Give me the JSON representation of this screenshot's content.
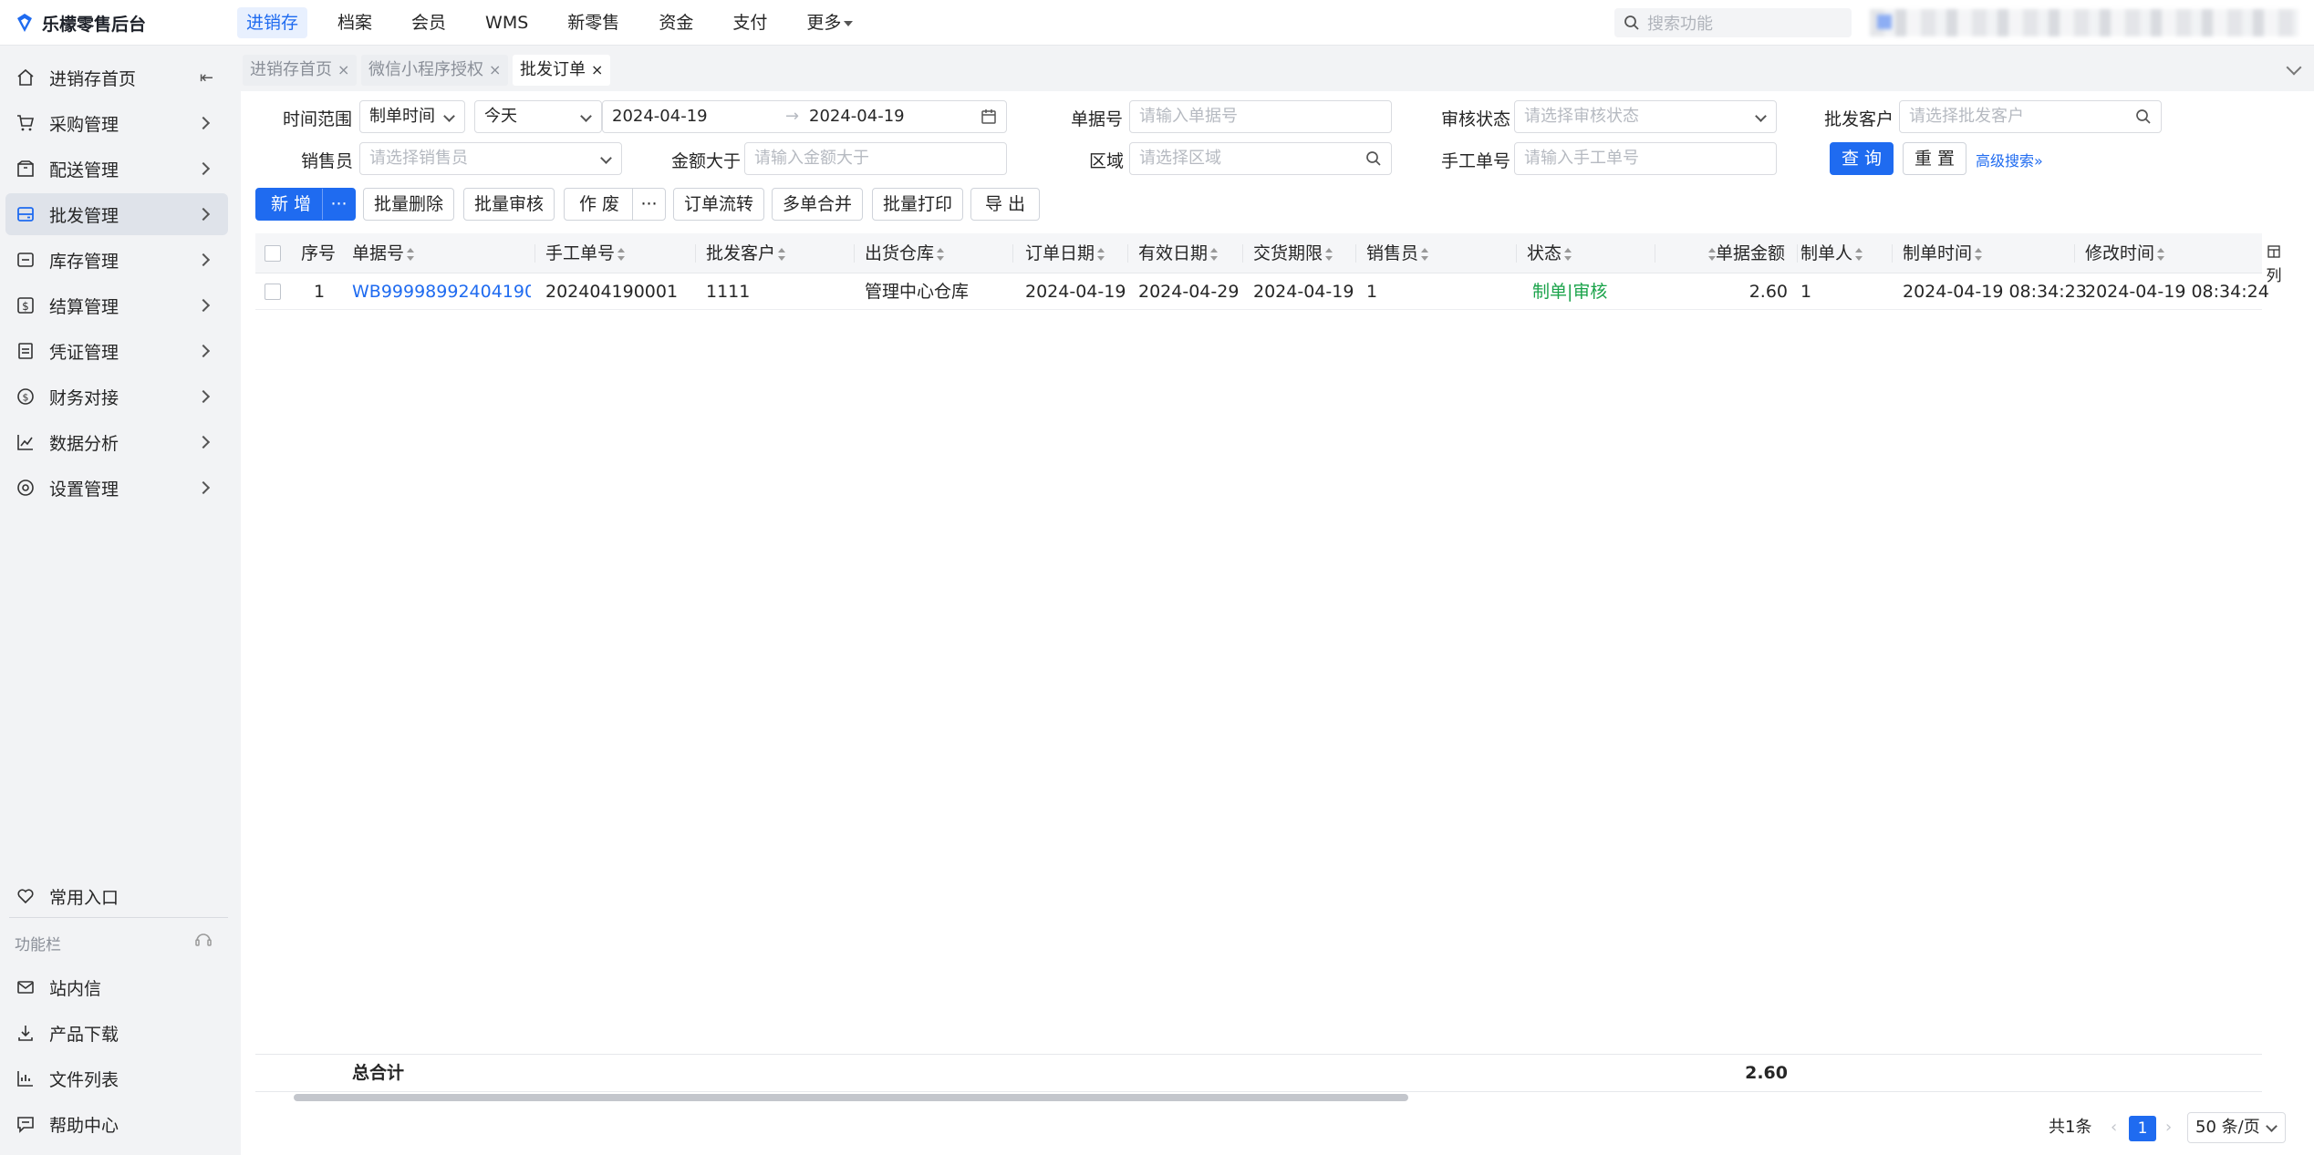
{
  "app": {
    "title": "乐檬零售后台"
  },
  "topnav": {
    "items": [
      "进销存",
      "档案",
      "会员",
      "WMS",
      "新零售",
      "资金",
      "支付",
      "更多"
    ],
    "search_placeholder": "搜索功能"
  },
  "sidebar": {
    "items": [
      {
        "label": "进销存首页",
        "icon": "home-icon"
      },
      {
        "label": "采购管理",
        "icon": "cart-icon"
      },
      {
        "label": "配送管理",
        "icon": "box-icon"
      },
      {
        "label": "批发管理",
        "icon": "wholesale-icon"
      },
      {
        "label": "库存管理",
        "icon": "inventory-icon"
      },
      {
        "label": "结算管理",
        "icon": "settlement-icon"
      },
      {
        "label": "凭证管理",
        "icon": "voucher-icon"
      },
      {
        "label": "财务对接",
        "icon": "finance-icon"
      },
      {
        "label": "数据分析",
        "icon": "chart-icon"
      },
      {
        "label": "设置管理",
        "icon": "settings-icon"
      }
    ],
    "favorites_label": "常用入口",
    "function_bar_label": "功能栏",
    "bottom_items": [
      {
        "label": "站内信",
        "icon": "mail-icon"
      },
      {
        "label": "产品下载",
        "icon": "download-icon"
      },
      {
        "label": "文件列表",
        "icon": "file-list-icon"
      },
      {
        "label": "帮助中心",
        "icon": "help-icon"
      }
    ]
  },
  "tabs": [
    "进销存首页",
    "微信小程序授权",
    "批发订单"
  ],
  "filters": {
    "time_range_label": "时间范围",
    "time_type": "制单时间",
    "time_preset": "今天",
    "date_start": "2024-04-19",
    "date_end": "2024-04-19",
    "doc_no_label": "单据号",
    "doc_no_placeholder": "请输入单据号",
    "audit_status_label": "审核状态",
    "audit_status_placeholder": "请选择审核状态",
    "customer_label": "批发客户",
    "customer_placeholder": "请选择批发客户",
    "salesperson_label": "销售员",
    "salesperson_placeholder": "请选择销售员",
    "amount_label": "金额大于",
    "amount_placeholder": "请输入金额大于",
    "region_label": "区域",
    "region_placeholder": "请选择区域",
    "manual_no_label": "手工单号",
    "manual_no_placeholder": "请输入手工单号",
    "query": "查 询",
    "reset": "重 置",
    "advanced": "高级搜索"
  },
  "toolbar": {
    "add": "新 增",
    "batch_delete": "批量删除",
    "batch_audit": "批量审核",
    "void": "作 废",
    "order_flow": "订单流转",
    "merge": "多单合并",
    "batch_print": "批量打印",
    "export": "导 出",
    "more": "···"
  },
  "table": {
    "columns": [
      "序号",
      "单据号",
      "手工单号",
      "批发客户",
      "出货仓库",
      "订单日期",
      "有效日期",
      "交货期限",
      "销售员",
      "状态",
      "单据金额",
      "制单人",
      "制单时间",
      "修改时间"
    ],
    "rows": [
      {
        "seq": "1",
        "doc_no": "WB99998992404190...",
        "manual_no": "202404190001",
        "customer": "1111",
        "warehouse": "管理中心仓库",
        "order_date": "2024-04-19",
        "valid_date": "2024-04-29",
        "delivery_deadline": "2024-04-19",
        "salesperson": "1",
        "status": "制单|审核",
        "amount": "2.60",
        "creator": "1",
        "created_at": "2024-04-19 08:34:23",
        "modified_at": "2024-04-19 08:34:24"
      }
    ],
    "total_label": "总合计",
    "total_amount": "2.60",
    "column_setting": "列"
  },
  "pagination": {
    "total": "共1条",
    "current_page": "1",
    "page_size": "50 条/页"
  },
  "colors": {
    "primary": "#1f6bf0",
    "status_green": "#1aa34a"
  }
}
